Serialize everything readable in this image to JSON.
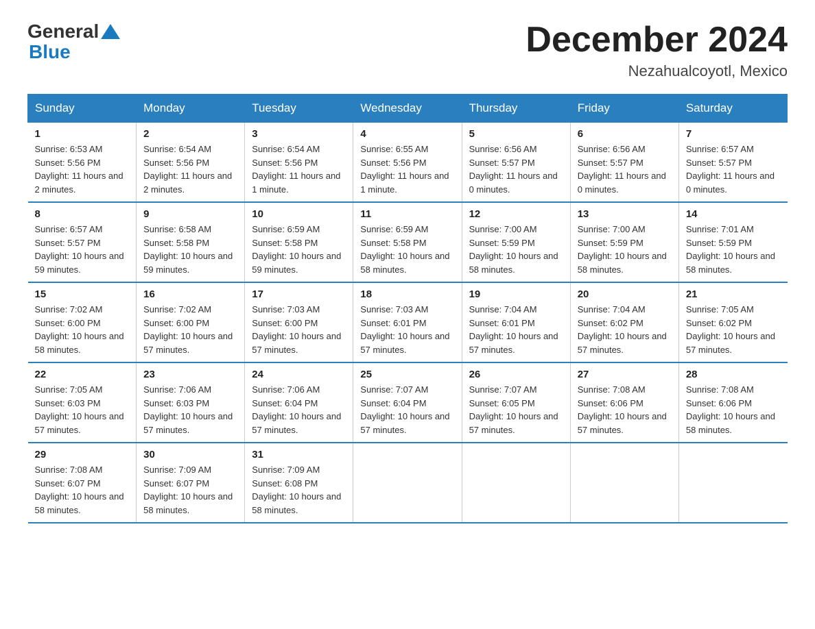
{
  "header": {
    "logo_general": "General",
    "logo_blue": "Blue",
    "month_year": "December 2024",
    "location": "Nezahualcoyotl, Mexico"
  },
  "days_of_week": [
    "Sunday",
    "Monday",
    "Tuesday",
    "Wednesday",
    "Thursday",
    "Friday",
    "Saturday"
  ],
  "weeks": [
    [
      {
        "day": "1",
        "sunrise": "6:53 AM",
        "sunset": "5:56 PM",
        "daylight": "11 hours and 2 minutes."
      },
      {
        "day": "2",
        "sunrise": "6:54 AM",
        "sunset": "5:56 PM",
        "daylight": "11 hours and 2 minutes."
      },
      {
        "day": "3",
        "sunrise": "6:54 AM",
        "sunset": "5:56 PM",
        "daylight": "11 hours and 1 minute."
      },
      {
        "day": "4",
        "sunrise": "6:55 AM",
        "sunset": "5:56 PM",
        "daylight": "11 hours and 1 minute."
      },
      {
        "day": "5",
        "sunrise": "6:56 AM",
        "sunset": "5:57 PM",
        "daylight": "11 hours and 0 minutes."
      },
      {
        "day": "6",
        "sunrise": "6:56 AM",
        "sunset": "5:57 PM",
        "daylight": "11 hours and 0 minutes."
      },
      {
        "day": "7",
        "sunrise": "6:57 AM",
        "sunset": "5:57 PM",
        "daylight": "11 hours and 0 minutes."
      }
    ],
    [
      {
        "day": "8",
        "sunrise": "6:57 AM",
        "sunset": "5:57 PM",
        "daylight": "10 hours and 59 minutes."
      },
      {
        "day": "9",
        "sunrise": "6:58 AM",
        "sunset": "5:58 PM",
        "daylight": "10 hours and 59 minutes."
      },
      {
        "day": "10",
        "sunrise": "6:59 AM",
        "sunset": "5:58 PM",
        "daylight": "10 hours and 59 minutes."
      },
      {
        "day": "11",
        "sunrise": "6:59 AM",
        "sunset": "5:58 PM",
        "daylight": "10 hours and 58 minutes."
      },
      {
        "day": "12",
        "sunrise": "7:00 AM",
        "sunset": "5:59 PM",
        "daylight": "10 hours and 58 minutes."
      },
      {
        "day": "13",
        "sunrise": "7:00 AM",
        "sunset": "5:59 PM",
        "daylight": "10 hours and 58 minutes."
      },
      {
        "day": "14",
        "sunrise": "7:01 AM",
        "sunset": "5:59 PM",
        "daylight": "10 hours and 58 minutes."
      }
    ],
    [
      {
        "day": "15",
        "sunrise": "7:02 AM",
        "sunset": "6:00 PM",
        "daylight": "10 hours and 58 minutes."
      },
      {
        "day": "16",
        "sunrise": "7:02 AM",
        "sunset": "6:00 PM",
        "daylight": "10 hours and 57 minutes."
      },
      {
        "day": "17",
        "sunrise": "7:03 AM",
        "sunset": "6:00 PM",
        "daylight": "10 hours and 57 minutes."
      },
      {
        "day": "18",
        "sunrise": "7:03 AM",
        "sunset": "6:01 PM",
        "daylight": "10 hours and 57 minutes."
      },
      {
        "day": "19",
        "sunrise": "7:04 AM",
        "sunset": "6:01 PM",
        "daylight": "10 hours and 57 minutes."
      },
      {
        "day": "20",
        "sunrise": "7:04 AM",
        "sunset": "6:02 PM",
        "daylight": "10 hours and 57 minutes."
      },
      {
        "day": "21",
        "sunrise": "7:05 AM",
        "sunset": "6:02 PM",
        "daylight": "10 hours and 57 minutes."
      }
    ],
    [
      {
        "day": "22",
        "sunrise": "7:05 AM",
        "sunset": "6:03 PM",
        "daylight": "10 hours and 57 minutes."
      },
      {
        "day": "23",
        "sunrise": "7:06 AM",
        "sunset": "6:03 PM",
        "daylight": "10 hours and 57 minutes."
      },
      {
        "day": "24",
        "sunrise": "7:06 AM",
        "sunset": "6:04 PM",
        "daylight": "10 hours and 57 minutes."
      },
      {
        "day": "25",
        "sunrise": "7:07 AM",
        "sunset": "6:04 PM",
        "daylight": "10 hours and 57 minutes."
      },
      {
        "day": "26",
        "sunrise": "7:07 AM",
        "sunset": "6:05 PM",
        "daylight": "10 hours and 57 minutes."
      },
      {
        "day": "27",
        "sunrise": "7:08 AM",
        "sunset": "6:06 PM",
        "daylight": "10 hours and 57 minutes."
      },
      {
        "day": "28",
        "sunrise": "7:08 AM",
        "sunset": "6:06 PM",
        "daylight": "10 hours and 58 minutes."
      }
    ],
    [
      {
        "day": "29",
        "sunrise": "7:08 AM",
        "sunset": "6:07 PM",
        "daylight": "10 hours and 58 minutes."
      },
      {
        "day": "30",
        "sunrise": "7:09 AM",
        "sunset": "6:07 PM",
        "daylight": "10 hours and 58 minutes."
      },
      {
        "day": "31",
        "sunrise": "7:09 AM",
        "sunset": "6:08 PM",
        "daylight": "10 hours and 58 minutes."
      },
      null,
      null,
      null,
      null
    ]
  ]
}
